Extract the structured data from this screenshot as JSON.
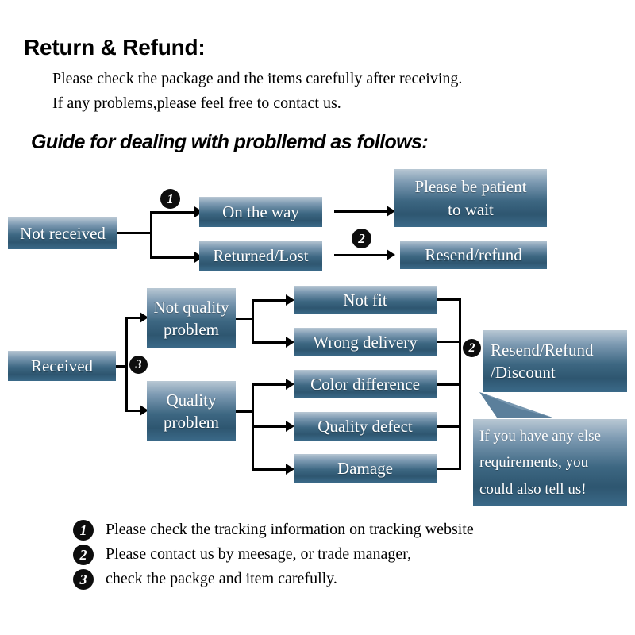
{
  "header": {
    "title": "Return & Refund:",
    "line1": "Please check the package and the items carefully after receiving.",
    "line2": "If any problems,please feel free to contact us.",
    "guide": "Guide for dealing with probllemd as follows:"
  },
  "flow_not_received": {
    "start": "Not received",
    "branch1": "On the way",
    "branch2": "Returned/Lost",
    "result1": "Please be patient\nto wait",
    "result2": "Resend/refund",
    "badge1": "1",
    "badge2": "2"
  },
  "flow_received": {
    "start": "Received",
    "badge3": "3",
    "badge2": "2",
    "group1": "Not quality\nproblem",
    "group2": "Quality\nproblem",
    "reasons": [
      "Not fit",
      "Wrong delivery",
      "Color difference",
      "Quality defect",
      "Damage"
    ],
    "result": "Resend/Refund\n/Discount",
    "callout": "If you have any else\nrequirements, you\ncould also tell us!"
  },
  "legend": [
    {
      "number": "1",
      "text": "Please check the tracking information on tracking website"
    },
    {
      "number": "2",
      "text": "Please contact us by meesage, or trade manager,"
    },
    {
      "number": "3",
      "text": "check the packge and item carefully."
    }
  ],
  "colors": {
    "box_gradient_top": "#b9c8d4",
    "box_gradient_mid": "#3d6782",
    "box_gradient_bottom": "#3b6a89",
    "badge_fill": "#0d0d0d",
    "text_on_box": "#ffffff",
    "line": "#000000",
    "page_bg": "#ffffff"
  }
}
